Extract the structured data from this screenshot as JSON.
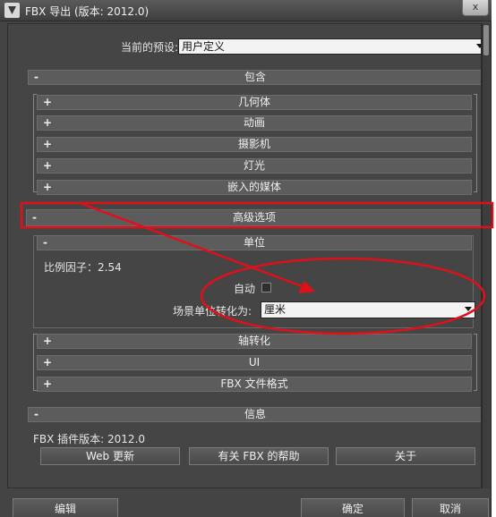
{
  "window": {
    "title": "FBX 导出 (版本: 2012.0)",
    "close_label": "x"
  },
  "preset": {
    "label": "当前的预设:",
    "value": "用户定义"
  },
  "rollouts": {
    "include": {
      "sign": "-",
      "label": "包含"
    },
    "geometry": {
      "sign": "+",
      "label": "几何体"
    },
    "animation": {
      "sign": "+",
      "label": "动画"
    },
    "camera": {
      "sign": "+",
      "label": "摄影机"
    },
    "lights": {
      "sign": "+",
      "label": "灯光"
    },
    "embed_media": {
      "sign": "+",
      "label": "嵌入的媒体"
    },
    "advanced": {
      "sign": "-",
      "label": "高级选项"
    },
    "units": {
      "sign": "-",
      "label": "单位"
    },
    "axis": {
      "sign": "+",
      "label": "轴转化"
    },
    "ui": {
      "sign": "+",
      "label": "UI"
    },
    "fbx_format": {
      "sign": "+",
      "label": "FBX 文件格式"
    },
    "info": {
      "sign": "-",
      "label": "信息"
    }
  },
  "units": {
    "scale_factor": "比例因子：2.54",
    "auto_label": "自动",
    "auto_checked": false,
    "convert_label": "场景单位转化为:",
    "convert_value": "厘米"
  },
  "info": {
    "plugin_version": "FBX 插件版本: 2012.0",
    "buttons": [
      "Web 更新",
      "有关 FBX 的帮助",
      "关于"
    ]
  },
  "footer": {
    "edit_label": "编辑",
    "ok_label": "确定",
    "cancel_label": "取消"
  },
  "colors": {
    "panel_bg": "#444444",
    "annotation_red": "#e0101a"
  }
}
